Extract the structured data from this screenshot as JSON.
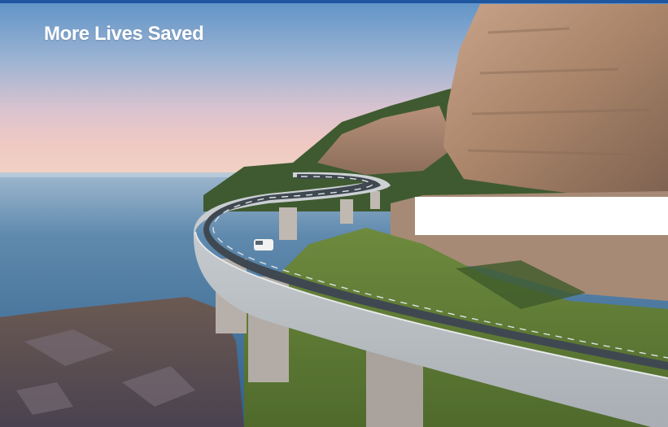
{
  "hero": {
    "headline": "More Lives Saved",
    "image_subject": "coastal-cliff-bridge-photo"
  },
  "colors": {
    "topbar": "#1e56a0",
    "headline": "#ffffff",
    "overlay_box": "#ffffff"
  }
}
